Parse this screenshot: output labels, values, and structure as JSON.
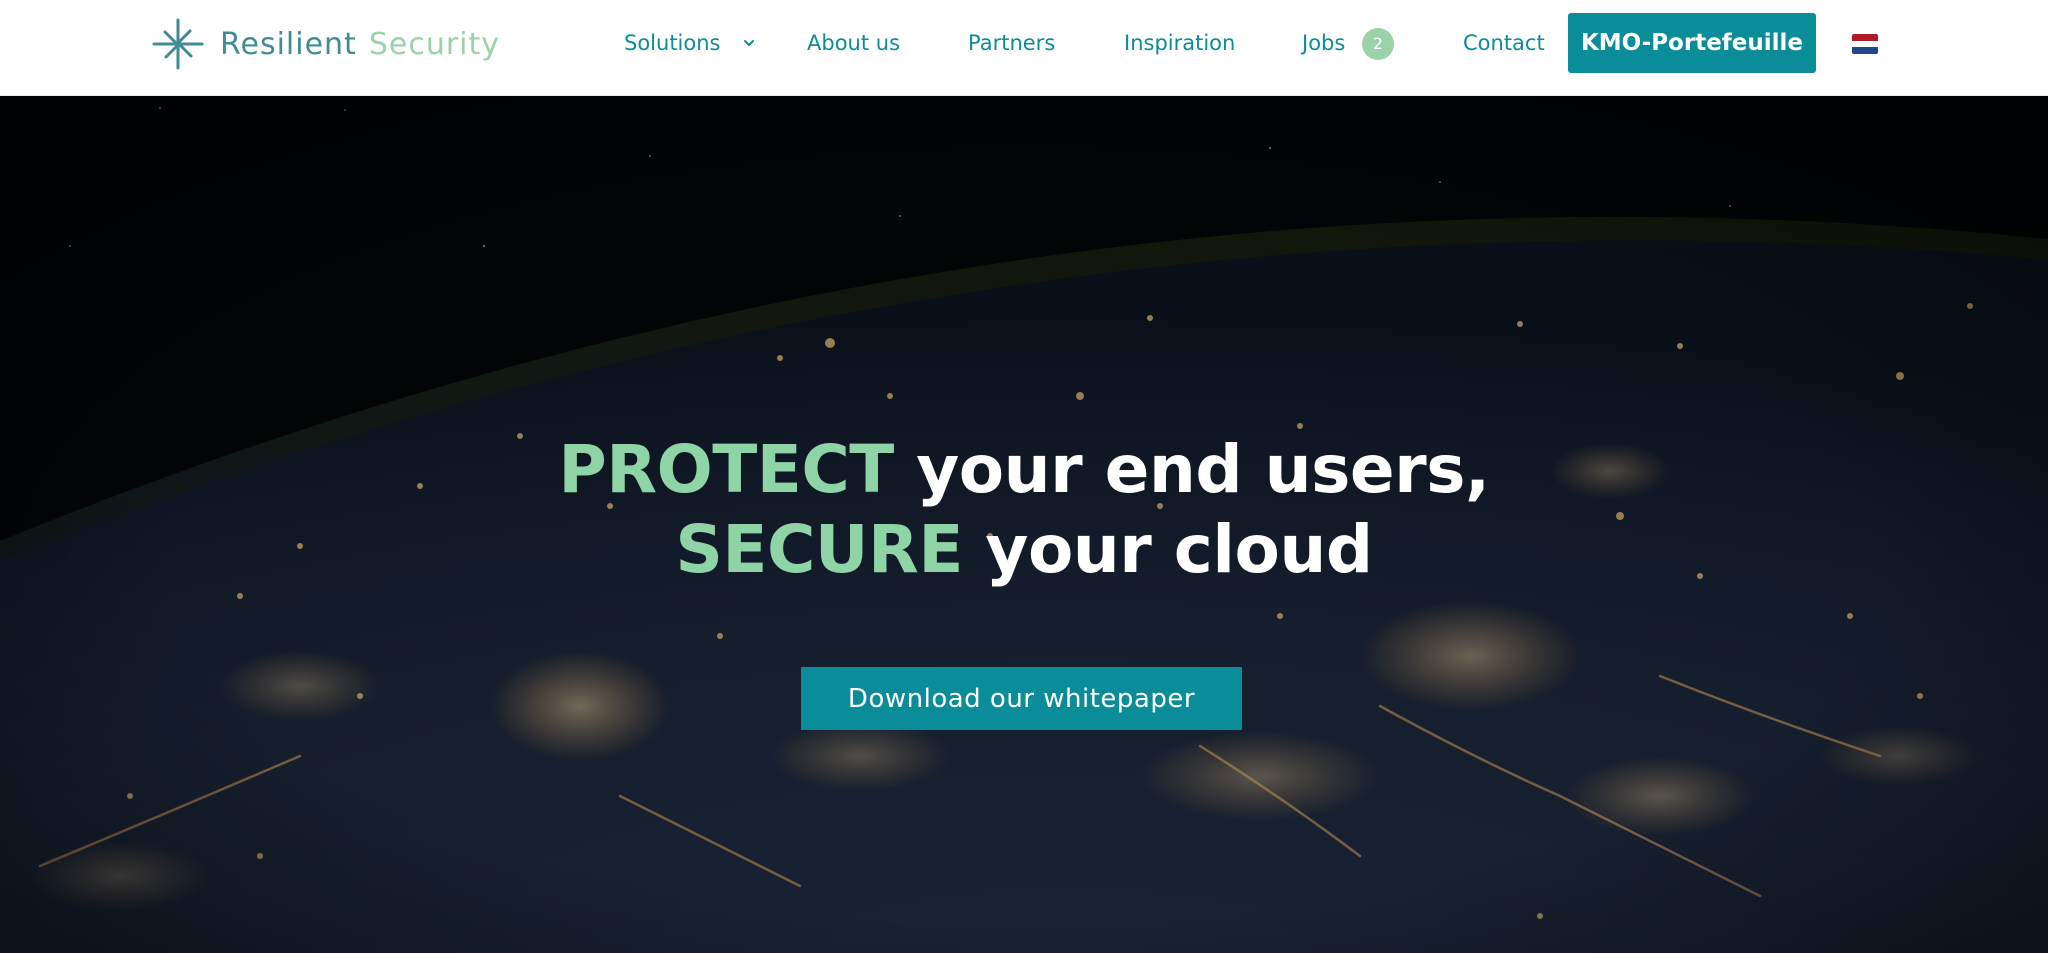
{
  "brand": {
    "name_part1": "Resilient",
    "name_part2": "Security",
    "logo_icon": "pinwheel-logo-icon"
  },
  "nav": {
    "solutions": "Solutions",
    "about": "About us",
    "partners": "Partners",
    "inspiration": "Inspiration",
    "jobs": "Jobs",
    "jobs_count": "2",
    "contact": "Contact",
    "cta": "KMO-Portefeuille",
    "language_icon": "dutch-flag-icon"
  },
  "hero": {
    "line1_accent": "PROTECT",
    "line1_rest": "your end users,",
    "line2_accent": "SECURE",
    "line2_rest": "your cloud",
    "button": "Download our whitepaper",
    "background": "earth-at-night-from-space"
  },
  "colors": {
    "primary": "#0b8c99",
    "accent": "#8fd4a6",
    "logo_dark": "#3f8c93",
    "logo_light": "#9ad3a8",
    "flag": [
      "#ae1c28",
      "#ffffff",
      "#21468b"
    ]
  }
}
